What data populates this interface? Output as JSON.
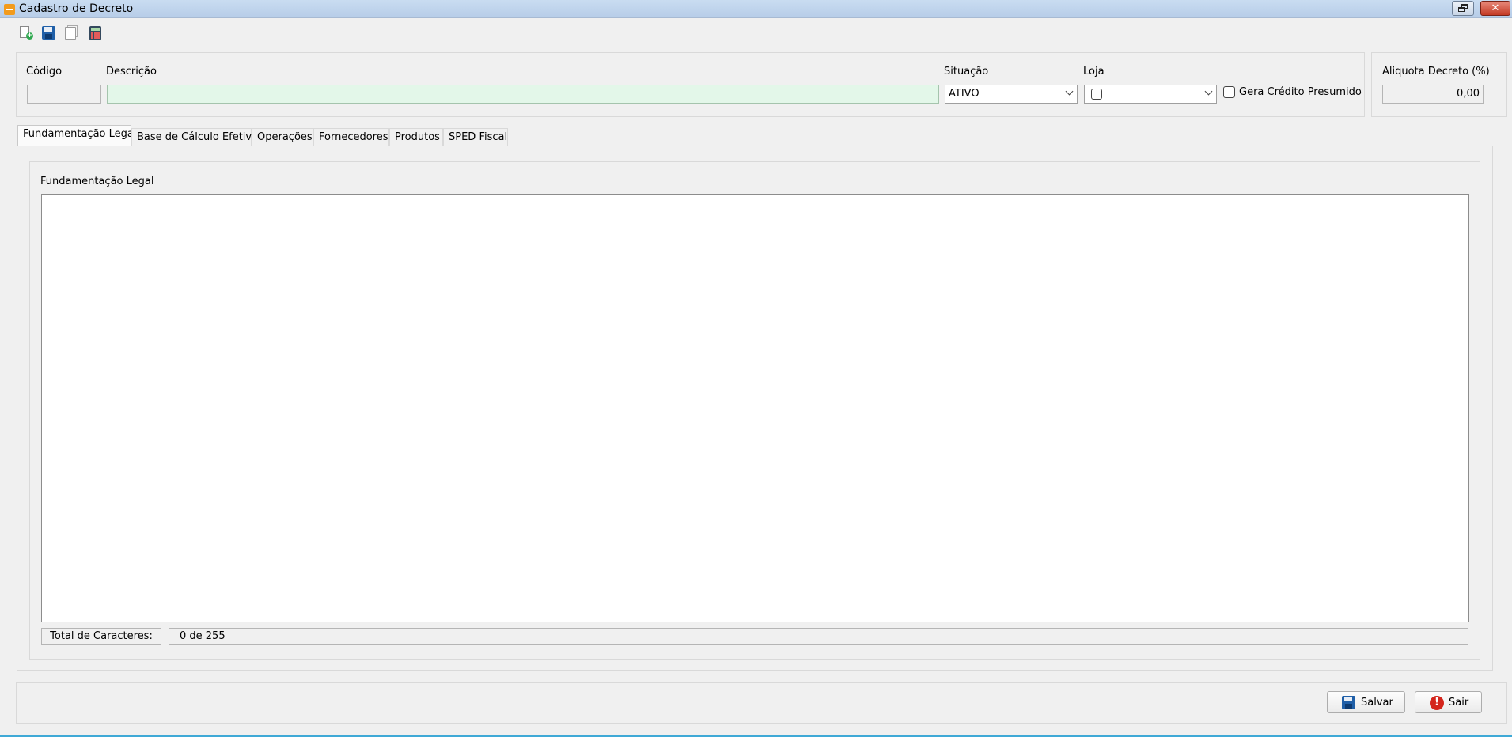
{
  "window": {
    "title": "Cadastro de Decreto",
    "close_glyph": "✕"
  },
  "toolbar": {
    "icons": [
      "new-document-icon",
      "save-icon",
      "copy-icon",
      "calculator-icon"
    ]
  },
  "header": {
    "codigo_label": "Código",
    "codigo_value": "",
    "descricao_label": "Descrição",
    "descricao_value": "",
    "situacao_label": "Situação",
    "situacao_value": "ATIVO",
    "loja_label": "Loja",
    "loja_value": "",
    "gera_credito_label": "Gera Crédito Presumido",
    "gera_credito_checked": false,
    "aliquota_label": "Aliquota Decreto (%)",
    "aliquota_value": "0,00"
  },
  "tabs": [
    {
      "label": "Fundamentação Legal",
      "active": true
    },
    {
      "label": "Base de Cálculo Efetiva",
      "active": false
    },
    {
      "label": "Operações",
      "active": false
    },
    {
      "label": "Fornecedores",
      "active": false
    },
    {
      "label": "Produtos",
      "active": false
    },
    {
      "label": "SPED Fiscal",
      "active": false
    }
  ],
  "fundamentacao": {
    "group_label": "Fundamentação Legal",
    "text": "",
    "total_label": "Total de Caracteres:",
    "total_value": "0 de 255"
  },
  "footer": {
    "save_label": "Salvar",
    "exit_label": "Sair",
    "exit_glyph": "!"
  },
  "colors": {
    "title_gradient": "#c9dcf1",
    "close_red": "#c43b26",
    "description_field_bg": "#e3f7e9",
    "save_icon_blue": "#1f5fa8",
    "exit_icon_red": "#d4251c"
  }
}
